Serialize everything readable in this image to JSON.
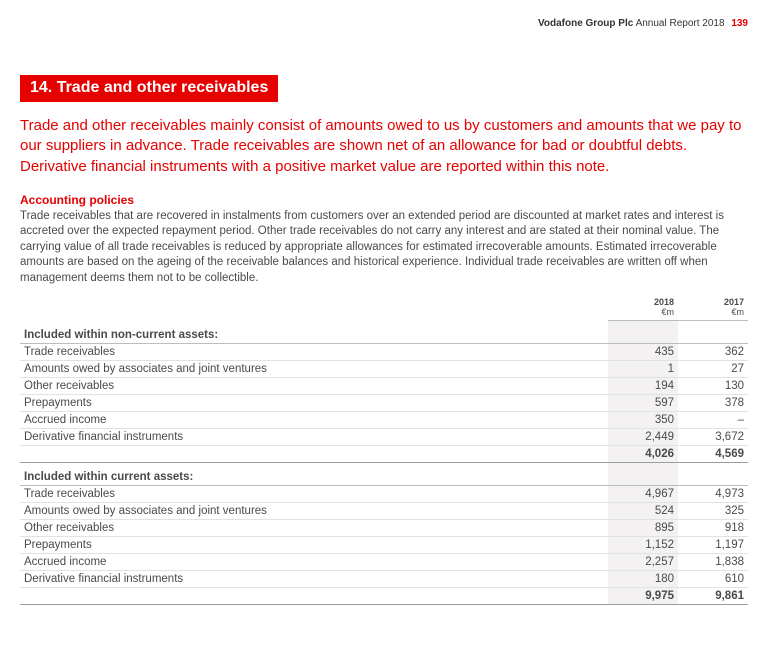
{
  "header": {
    "company": "Vodafone Group Plc",
    "report": "Annual Report 2018",
    "page": "139"
  },
  "section_badge": "14. Trade and other receivables",
  "intro": "Trade and other receivables mainly consist of amounts owed to us by customers and amounts that we pay to our suppliers in advance. Trade receivables are shown net of an allowance for bad or doubtful debts. Derivative financial instruments with a positive market value are reported within this note.",
  "subhead": "Accounting policies",
  "policy": "Trade receivables that are recovered in instalments from customers over an extended period are discounted at market rates and interest is accreted over the expected repayment period. Other trade receivables do not carry any interest and are stated at their nominal value. The carrying value of all trade receivables is reduced by appropriate allowances for estimated irrecoverable amounts. Estimated irrecoverable amounts are based on the ageing of the receivable balances and historical experience. Individual trade receivables are written off when management deems them not to be collectible.",
  "columns": {
    "y2018": "2018",
    "y2017": "2017",
    "unit": "€m"
  },
  "noncurrent": {
    "heading": "Included within non-current assets:",
    "rows": [
      {
        "label": "Trade receivables",
        "v2018": "435",
        "v2017": "362"
      },
      {
        "label": "Amounts owed by associates and joint ventures",
        "v2018": "1",
        "v2017": "27"
      },
      {
        "label": "Other receivables",
        "v2018": "194",
        "v2017": "130"
      },
      {
        "label": "Prepayments",
        "v2018": "597",
        "v2017": "378"
      },
      {
        "label": "Accrued income",
        "v2018": "350",
        "v2017": "–"
      },
      {
        "label": "Derivative financial instruments",
        "v2018": "2,449",
        "v2017": "3,672"
      }
    ],
    "total": {
      "v2018": "4,026",
      "v2017": "4,569"
    }
  },
  "current": {
    "heading": "Included within current assets:",
    "rows": [
      {
        "label": "Trade receivables",
        "v2018": "4,967",
        "v2017": "4,973"
      },
      {
        "label": "Amounts owed by associates and joint ventures",
        "v2018": "524",
        "v2017": "325"
      },
      {
        "label": "Other receivables",
        "v2018": "895",
        "v2017": "918"
      },
      {
        "label": "Prepayments",
        "v2018": "1,152",
        "v2017": "1,197"
      },
      {
        "label": "Accrued income",
        "v2018": "2,257",
        "v2017": "1,838"
      },
      {
        "label": "Derivative financial instruments",
        "v2018": "180",
        "v2017": "610"
      }
    ],
    "total": {
      "v2018": "9,975",
      "v2017": "9,861"
    }
  }
}
